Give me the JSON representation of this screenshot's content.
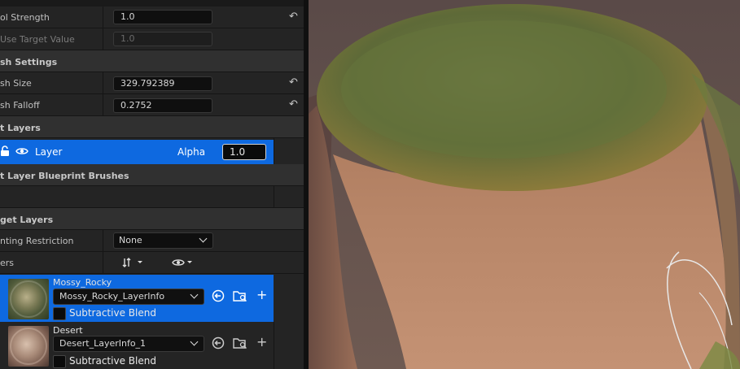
{
  "tool_strength": {
    "label": "ol Strength",
    "value": "1.0"
  },
  "use_target_value": {
    "label": " Use Target Value",
    "value": "1.0"
  },
  "brush_settings": {
    "title": "sh Settings"
  },
  "brush_size": {
    "label": "sh Size",
    "value": "329.792389"
  },
  "brush_falloff": {
    "label": "sh Falloff",
    "value": "0.2752"
  },
  "edit_layers": {
    "title": "t Layers"
  },
  "layer": {
    "name": "Layer",
    "alpha_label": "Alpha",
    "alpha_value": "1.0"
  },
  "edit_layer_bp": {
    "title": "t Layer Blueprint Brushes"
  },
  "target_layers": {
    "title": "get Layers"
  },
  "painting_restriction": {
    "label": "nting Restriction",
    "value": "None"
  },
  "layers_row": {
    "label": "ers"
  },
  "targets": [
    {
      "name": "Mossy_Rocky",
      "info": "Mossy_Rocky_LayerInfo",
      "blend_label": "Subtractive Blend"
    },
    {
      "name": "Desert",
      "info": "Desert_LayerInfo_1",
      "blend_label": "Subtractive Blend"
    }
  ],
  "icons": {
    "reset": "reset-arrow-icon",
    "lock": "unlock-icon",
    "eye": "eye-icon",
    "sort": "sort-icon",
    "visibility": "visibility-icon",
    "use": "use-selected-icon",
    "browse": "browse-folder-icon",
    "add": "plus-icon"
  },
  "colors": {
    "selection": "#0e69e0",
    "panel": "#242424",
    "category": "#303030"
  }
}
